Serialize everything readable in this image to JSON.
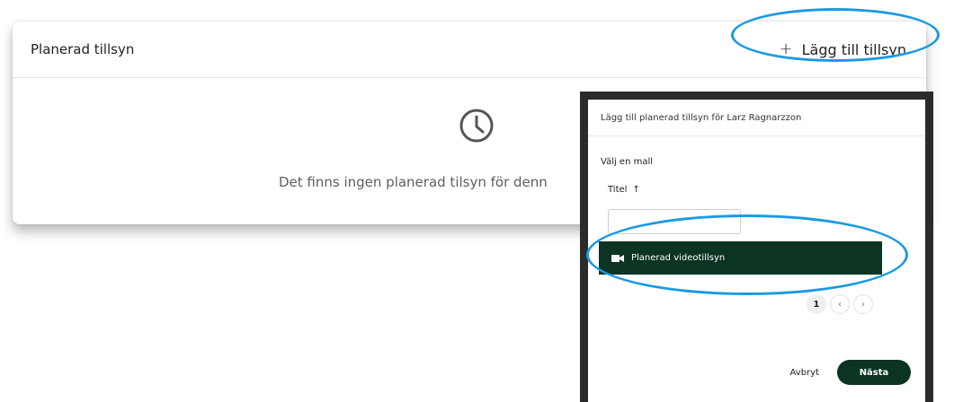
{
  "card": {
    "title": "Planerad tillsyn",
    "add_label": "Lägg till tillsyn",
    "add_symbol": "+",
    "empty_text": "Det finns ingen planerad tilsyn för denn"
  },
  "modal": {
    "title": "Lägg till planerad tillsyn för Larz Ragnarzzon",
    "section_label": "Välj en mall",
    "column_header": "Titel",
    "sort_symbol": "↑",
    "filter_value": "",
    "templates": [
      {
        "label": "Planerad videotillsyn",
        "icon": "video-camera-icon",
        "selected": true
      }
    ],
    "pagination": {
      "current_page": "1",
      "prev_symbol": "‹",
      "next_symbol": "›"
    },
    "cancel_label": "Avbryt",
    "next_label": "Nästa"
  },
  "colors": {
    "primary": "#0c3423",
    "highlight": "#1a9ae2",
    "muted_text": "#5e5e5e"
  }
}
